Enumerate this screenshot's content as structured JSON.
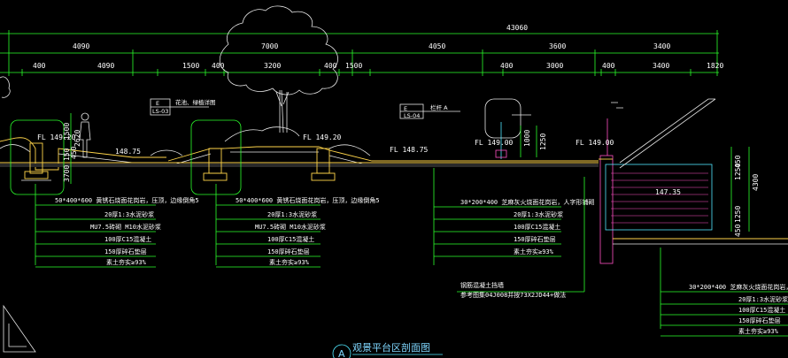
{
  "drawing": {
    "title": "观景平台区剖面图",
    "title_marker": "A",
    "overall_dim": "43060",
    "dim_row1": [
      "4090",
      "7000",
      "4050",
      "3600",
      "3400"
    ],
    "dim_row2": [
      "400",
      "4090",
      "1500",
      "400",
      "3200",
      "400",
      "1500",
      "400",
      "3000",
      "400",
      "3400",
      "1820"
    ],
    "vertical_dims": [
      "1500",
      "2620",
      "150",
      "450",
      "3700",
      "1000",
      "1250",
      "1250",
      "4300",
      "450",
      "1250",
      "450"
    ],
    "elevations": [
      "FL 149.20",
      "148.75",
      "FL 149.20",
      "FL 148.75",
      "FL 149.00",
      "FL 149.00",
      "147.35"
    ],
    "callout_tags": [
      {
        "code": "LS-03",
        "note": "花池、绿植详图"
      },
      {
        "code": "LS-04",
        "note": "栏杆 A"
      }
    ],
    "layers_1": [
      "50*400*600 黄锈石烧面花岗岩，压顶，边缘倒角5",
      "20厚1:3水泥砂浆",
      "MU7.5砖砌 M10水泥砂浆",
      "100厚C15混凝土",
      "150厚碎石垫层",
      "素土夯实≥93%"
    ],
    "layers_2": [
      "50*400*600 黄锈石烧面花岗岩，压顶，边缘倒角5",
      "20厚1:3水泥砂浆",
      "MU7.5砖砌 M10水泥砂浆",
      "100厚C15混凝土",
      "150厚碎石垫层",
      "素土夯实≥93%"
    ],
    "layers_3": [
      "30*200*400 芝麻灰火烧面花岗岩，人字形铺砌",
      "20厚1:3水泥砂浆",
      "100厚C15混凝土",
      "150厚碎石垫层",
      "素土夯实≥93%"
    ],
    "layers_4": [
      "30*200*400 芝麻灰火烧面花岗岩，人字形铺砌",
      "20厚1:3水泥砂浆",
      "100厚C15混凝土",
      "150厚碎石垫层",
      "素土夯实≥93%"
    ],
    "wall_note_1": "钢筋混凝土挡墙",
    "wall_note_2": "参考图集04J008并按73X2JD44+做法"
  }
}
